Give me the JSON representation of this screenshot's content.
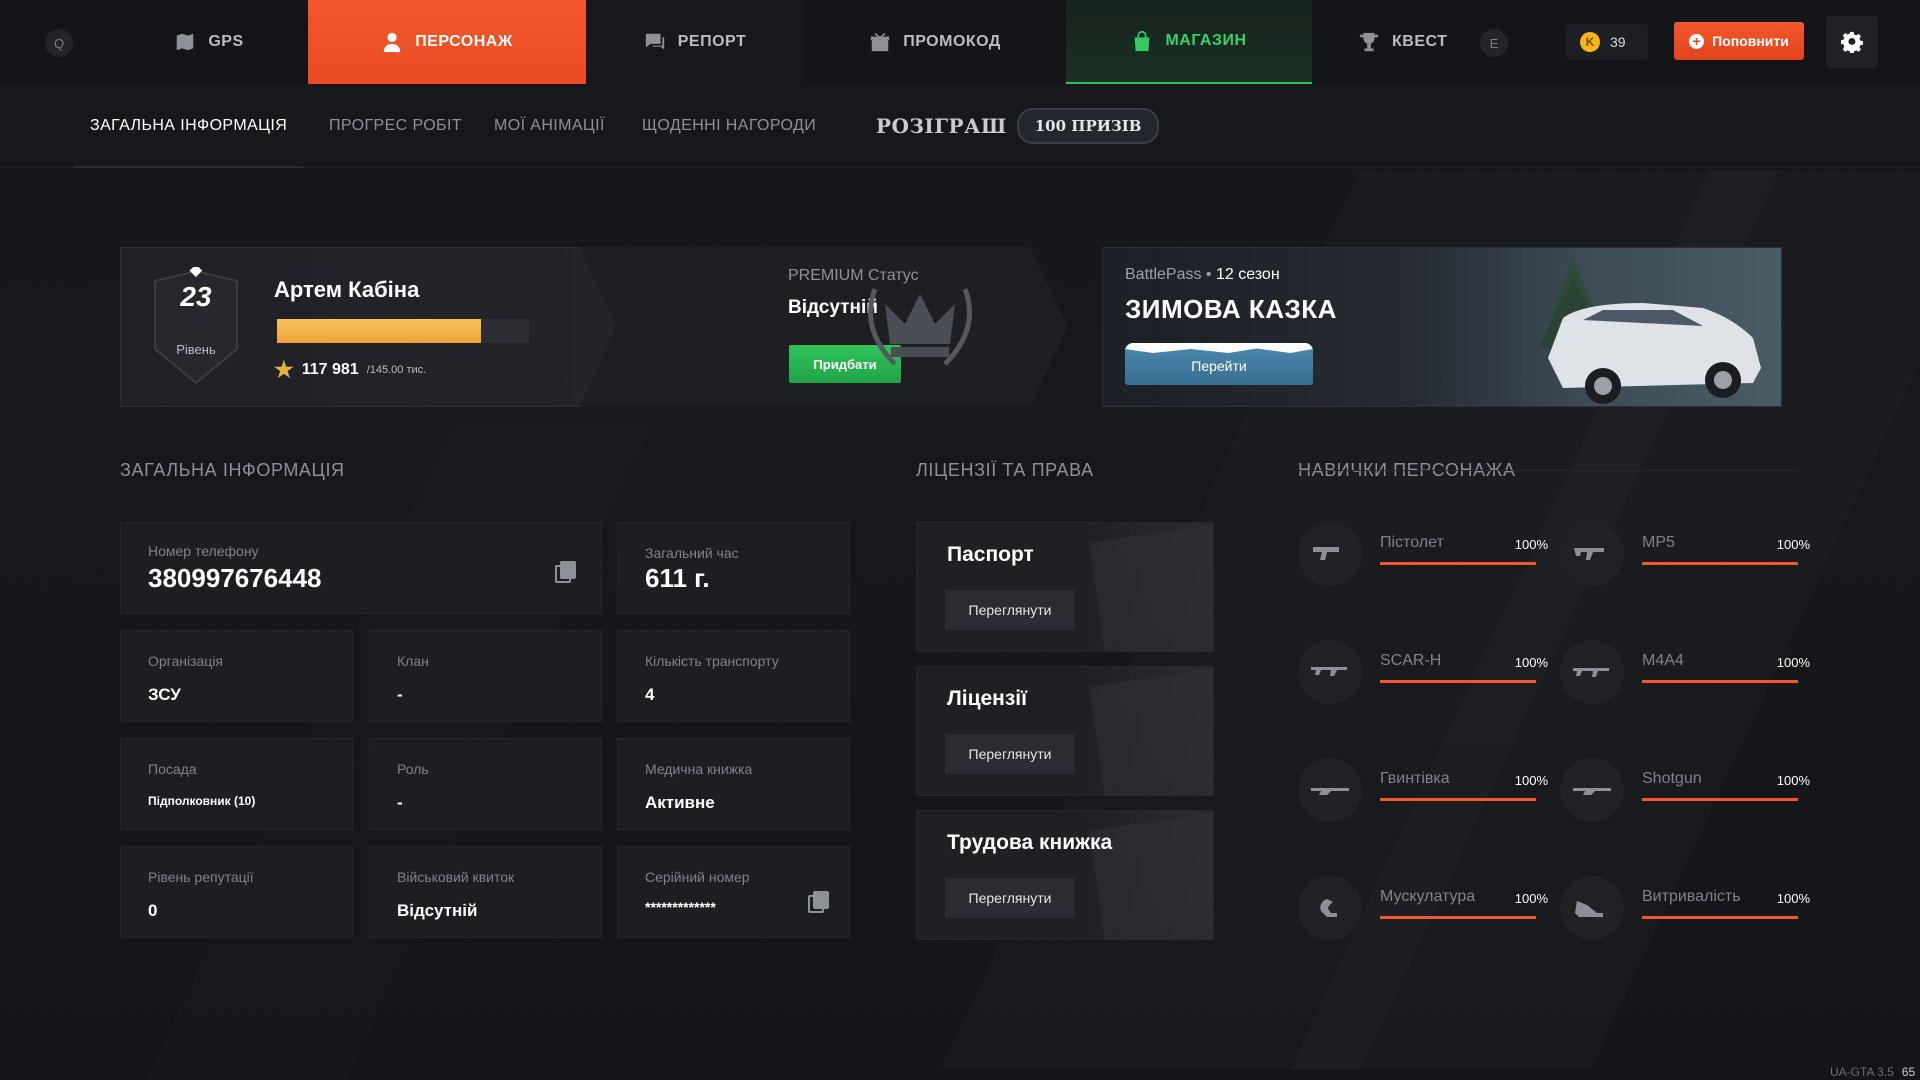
{
  "topnav": {
    "key_left": "Q",
    "key_right": "E",
    "tabs": [
      {
        "label": "GPS"
      },
      {
        "label": "ПЕРСОНАЖ"
      },
      {
        "label": "РЕПОРТ"
      },
      {
        "label": "ПРОМОКОД"
      },
      {
        "label": "МАГАЗИН"
      },
      {
        "label": "КВЕСТ"
      }
    ],
    "coin_symbol": "K",
    "balance": "39",
    "topup_label": "Поповнити",
    "accent": "#f2582c",
    "shop_color": "#35c962"
  },
  "subnav": {
    "tabs": [
      {
        "label": "ЗАГАЛЬНА ІНФОРМАЦІЯ"
      },
      {
        "label": "ПРОГРЕС РОБІТ"
      },
      {
        "label": "МОЇ АНІМАЦІЇ"
      },
      {
        "label": "ЩОДЕННІ НАГОРОДИ"
      }
    ],
    "raffle_word": "РОЗІГРАШ",
    "raffle_badge": "100 ПРИЗІВ"
  },
  "profile": {
    "level": "23",
    "level_label": "Рівень",
    "name": "Артем Кабіна",
    "xp_current": "117 981",
    "xp_max": "/145.00 тис.",
    "xp_progress": 0.81
  },
  "premium": {
    "label": "PREMIUM Статус",
    "value": "Відсутній",
    "buy_label": "Придбати"
  },
  "battlepass": {
    "name": "BattlePass",
    "season": "12 сезон",
    "title": "ЗИМОВА КАЗКА",
    "button": "Перейти"
  },
  "general": {
    "title": "ЗАГАЛЬНА ІНФОРМАЦІЯ",
    "phone_label": "Номер телефону",
    "phone": "380997676448",
    "time_label": "Загальний час",
    "time": "611 г.",
    "org_label": "Організація",
    "org": "ЗСУ",
    "clan_label": "Клан",
    "clan": "-",
    "vehicles_label": "Кількість транспорту",
    "vehicles": "4",
    "position_label": "Посада",
    "position": "Підполковник (10)",
    "role_label": "Роль",
    "role": "-",
    "medbook_label": "Медична книжка",
    "medbook": "Активне",
    "rep_label": "Рівень репутації",
    "rep": "0",
    "military_label": "Військовий квиток",
    "military": "Відсутній",
    "serial_label": "Серійний номер",
    "serial": "*************"
  },
  "licenses": {
    "title": "ЛІЦЕНЗІЇ ТА ПРАВА",
    "items": [
      {
        "title": "Паспорт",
        "button": "Переглянути"
      },
      {
        "title": "Ліцензії",
        "button": "Переглянути"
      },
      {
        "title": "Трудова книжка",
        "button": "Переглянути"
      }
    ]
  },
  "skills": {
    "title": "НАВИЧКИ ПЕРСОНАЖА",
    "items": [
      {
        "name": "Пістолет",
        "percent": "100%",
        "level": 1.0,
        "icon": "pistol-icon"
      },
      {
        "name": "MP5",
        "percent": "100%",
        "level": 1.0,
        "icon": "smg-icon"
      },
      {
        "name": "SCAR-H",
        "percent": "100%",
        "level": 1.0,
        "icon": "rifle-icon"
      },
      {
        "name": "M4A4",
        "percent": "100%",
        "level": 1.0,
        "icon": "assault-rifle-icon"
      },
      {
        "name": "Гвинтівка",
        "percent": "100%",
        "level": 1.0,
        "icon": "sniper-rifle-icon"
      },
      {
        "name": "Shotgun",
        "percent": "100%",
        "level": 1.0,
        "icon": "shotgun-icon"
      },
      {
        "name": "Мускулатура",
        "percent": "100%",
        "level": 1.0,
        "icon": "muscle-icon"
      },
      {
        "name": "Витривалість",
        "percent": "100%",
        "level": 1.0,
        "icon": "sneaker-icon"
      }
    ]
  },
  "version": {
    "label": "UA-GTA 3.5",
    "value": "65"
  }
}
